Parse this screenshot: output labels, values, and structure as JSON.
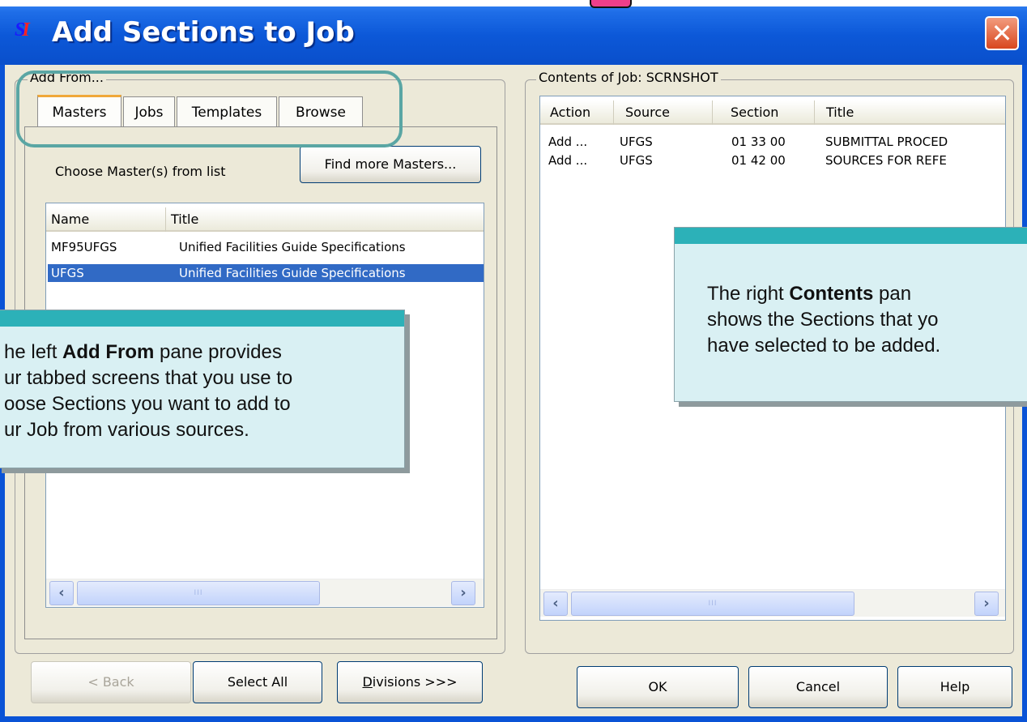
{
  "window": {
    "title": "Add Sections to Job",
    "app_icon_text": "S",
    "app_icon_text2": "I"
  },
  "add_from": {
    "label": "Add From...",
    "tabs": [
      {
        "label": "Masters"
      },
      {
        "label": "Jobs"
      },
      {
        "label": "Templates"
      },
      {
        "label": "Browse"
      }
    ],
    "prompt": "Choose Master(s) from list",
    "find_button": "Find more Masters...",
    "list": {
      "columns": [
        "Name",
        "Title"
      ],
      "rows": [
        {
          "name": "MF95UFGS",
          "title": "Unified Facilities Guide Specifications",
          "selected": false
        },
        {
          "name": "UFGS",
          "title": "Unified Facilities Guide Specifications",
          "selected": true
        }
      ]
    },
    "scroll_thumb_grip": "III"
  },
  "contents": {
    "label": "Contents of Job: SCRNSHOT",
    "columns": [
      "Action",
      "Source",
      "Section",
      "Title"
    ],
    "rows": [
      {
        "action": "Add ...",
        "source": "UFGS",
        "section": "01 33 00",
        "title": "SUBMITTAL PROCED"
      },
      {
        "action": "Add ...",
        "source": "UFGS",
        "section": "01 42 00",
        "title": "SOURCES FOR REFE"
      }
    ],
    "scroll_thumb_grip": "III"
  },
  "buttons": {
    "back": "< Back",
    "select_all": "Select All",
    "divisions": "Divisions >>>",
    "divisions_accel": "D",
    "divisions_rest": "ivisions >>>",
    "ok": "OK",
    "cancel": "Cancel",
    "help": "Help"
  },
  "callouts": {
    "left": {
      "line1_pre": "he left ",
      "line1_bold": "Add From",
      "line1_post": " pane provides",
      "line2": "ur tabbed screens that you use to",
      "line3": "oose Sections you want to add to",
      "line4": "ur Job from various sources."
    },
    "right": {
      "line1_pre": "The right ",
      "line1_bold": "Contents",
      "line1_post": " pan",
      "line2": "shows the Sections that yo",
      "line3": "have selected to be added."
    }
  },
  "colors": {
    "title_bar": "#0a53d6",
    "dialog_bg": "#ece9d8",
    "selection": "#316ac5",
    "callout_bg": "#d9f0f3",
    "callout_bar": "#2cb1b8",
    "highlight_ring": "#5aa6a4"
  }
}
